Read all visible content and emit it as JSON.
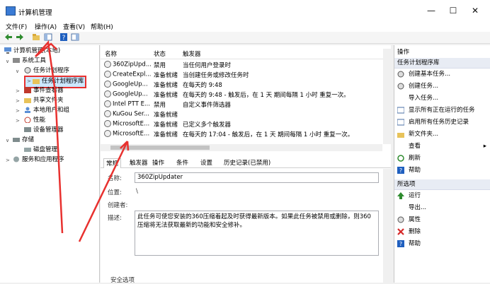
{
  "window": {
    "title": "计算机管理",
    "min": "—",
    "max": "☐",
    "close": "✕"
  },
  "menu": [
    "文件(F)",
    "操作(A)",
    "查看(V)",
    "帮助(H)"
  ],
  "tree": {
    "root": "计算机管理(本地)",
    "system_tools": "系统工具",
    "task_scheduler": "任务计划程序",
    "task_library": "任务计划程序库",
    "event_viewer": "事件查看器",
    "shared_folders": "共享文件夹",
    "local_users": "本地用户和组",
    "performance": "性能",
    "device_manager": "设备管理器",
    "storage": "存储",
    "disk_mgmt": "磁盘管理",
    "services": "服务和应用程序"
  },
  "list": {
    "headers": {
      "name": "名称",
      "status": "状态",
      "trigger": "触发器"
    },
    "rows": [
      {
        "name": "360ZipUpd...",
        "status": "禁用",
        "trigger": "当任何用户登录时"
      },
      {
        "name": "CreateExpl...",
        "status": "准备就绪",
        "trigger": "当创建任务或修改任务时"
      },
      {
        "name": "GoogleUp...",
        "status": "准备就绪",
        "trigger": "在每天的 9:48"
      },
      {
        "name": "GoogleUp...",
        "status": "准备就绪",
        "trigger": "在每天的 9:48 - 触发后，在 1 天 期间每隔 1 小时 重复一次。"
      },
      {
        "name": "Intel PTT E...",
        "status": "禁用",
        "trigger": "自定义事件筛选器"
      },
      {
        "name": "KuGou Ser...",
        "status": "准备就绪",
        "trigger": ""
      },
      {
        "name": "MicrosoftE...",
        "status": "准备就绪",
        "trigger": "已定义多个触发器"
      },
      {
        "name": "MicrosoftE...",
        "status": "准备就绪",
        "trigger": "在每天的 17:04 - 触发后，在 1 天 期间每隔 1 小时 重复一次。"
      }
    ]
  },
  "tabs": [
    "常规",
    "触发器",
    "操作",
    "条件",
    "设置",
    "历史记录(已禁用)"
  ],
  "detail": {
    "name_label": "名称:",
    "name_value": "360ZipUpdater",
    "location_label": "位置:",
    "location_value": "\\",
    "author_label": "创建者:",
    "desc_label": "描述:",
    "desc_value": "此任务可使您安装的360压缩着起及时获得最新版本。如果此任务被禁用或删除，则360压缩将无法获取最新的功能和安全修补。",
    "security_label": "安全选项"
  },
  "actions": {
    "header": "操作",
    "group1": "任务计划程序库",
    "items1": [
      "创建基本任务...",
      "创建任务...",
      "导入任务...",
      "显示所有正在运行的任务",
      "启用所有任务历史记录",
      "新文件夹...",
      "查看",
      "刷新",
      "帮助"
    ],
    "group2": "所选项",
    "items2": [
      "运行",
      "导出...",
      "属性",
      "删除",
      "帮助"
    ]
  },
  "colors": {
    "accent": "#3a7bd5",
    "annotation": "#e8312f",
    "selection": "#cce8ff"
  }
}
